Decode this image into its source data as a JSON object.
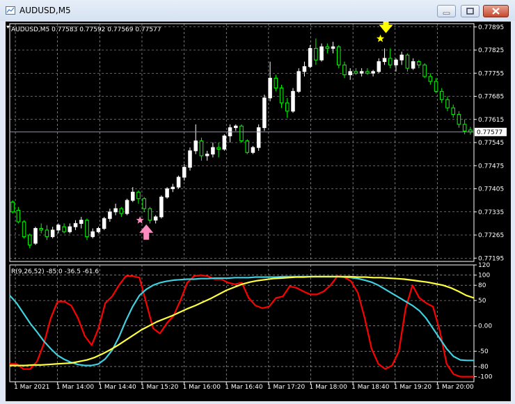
{
  "window": {
    "title": "AUDUSD,M5"
  },
  "main_chart": {
    "info_text": "AUDUSD,M5  0.77583 0.77592 0.77569 0.77577",
    "current_price_label": "0.77577",
    "price_labels": [
      "0.77895",
      "0.77825",
      "0.77755",
      "0.77685",
      "0.77615",
      "0.77545",
      "0.77475",
      "0.77405",
      "0.77335",
      "0.77265",
      "0.77195"
    ]
  },
  "indicator": {
    "info_text": "R(9,26,52) -85.0 -36.5 -61.6",
    "level_labels": [
      "120",
      "100",
      "80",
      "50",
      "0.00",
      "-50",
      "-80",
      "-100"
    ]
  },
  "time_labels": [
    "1 Mar 2021",
    "1 Mar 14:00",
    "1 Mar 14:40",
    "1 Mar 15:20",
    "1 Mar 16:00",
    "1 Mar 16:40",
    "1 Mar 17:20",
    "1 Mar 18:00",
    "1 Mar 18:40",
    "1 Mar 19:20",
    "1 Mar 20:00"
  ],
  "colors": {
    "bull": "#ffffff",
    "bear": "#00ff00",
    "grid": "#c0c0c0",
    "buy_signal": "#ff8cc0",
    "sell_signal": "#ffff00",
    "line_red": "#ff0000",
    "line_cyan": "#40d0e0",
    "line_yellow": "#ffff40"
  },
  "markers": [
    {
      "type": "buy-arrow",
      "icon": "up-arrow-icon",
      "candle_index": 23
    },
    {
      "type": "sell-arrow",
      "icon": "down-arrow-icon",
      "candle_index": 65
    }
  ],
  "chart_data": [
    {
      "type": "candlestick",
      "title": "AUDUSD,M5",
      "ylim": [
        0.77185,
        0.77905
      ],
      "x": [
        "1 Mar 2021",
        "1 Mar 14:00",
        "1 Mar 14:40",
        "1 Mar 15:20",
        "1 Mar 16:00",
        "1 Mar 16:40",
        "1 Mar 17:20",
        "1 Mar 18:00",
        "1 Mar 18:40",
        "1 Mar 19:20",
        "1 Mar 20:00"
      ],
      "ohlc": [
        [
          0.77365,
          0.7737,
          0.7733,
          0.77335
        ],
        [
          0.7734,
          0.7735,
          0.773,
          0.77305
        ],
        [
          0.77305,
          0.7731,
          0.77255,
          0.7726
        ],
        [
          0.77265,
          0.7727,
          0.77225,
          0.77235
        ],
        [
          0.7724,
          0.7729,
          0.77235,
          0.77285
        ],
        [
          0.77285,
          0.773,
          0.7727,
          0.7728
        ],
        [
          0.7728,
          0.77295,
          0.7725,
          0.7726
        ],
        [
          0.7726,
          0.7729,
          0.77255,
          0.7728
        ],
        [
          0.7728,
          0.773,
          0.7727,
          0.77295
        ],
        [
          0.7729,
          0.773,
          0.7727,
          0.77275
        ],
        [
          0.77275,
          0.773,
          0.7727,
          0.7729
        ],
        [
          0.7729,
          0.7731,
          0.7728,
          0.773
        ],
        [
          0.773,
          0.7732,
          0.77285,
          0.7731
        ],
        [
          0.7731,
          0.77315,
          0.7725,
          0.7726
        ],
        [
          0.7726,
          0.77285,
          0.77255,
          0.77275
        ],
        [
          0.77275,
          0.7729,
          0.7727,
          0.77285
        ],
        [
          0.77285,
          0.7732,
          0.7728,
          0.77315
        ],
        [
          0.77315,
          0.77345,
          0.77305,
          0.77335
        ],
        [
          0.77335,
          0.7736,
          0.77325,
          0.77345
        ],
        [
          0.77345,
          0.7735,
          0.7732,
          0.7733
        ],
        [
          0.7733,
          0.77375,
          0.77325,
          0.7737
        ],
        [
          0.7737,
          0.7741,
          0.77365,
          0.77395
        ],
        [
          0.77395,
          0.774,
          0.7736,
          0.77375
        ],
        [
          0.77375,
          0.7738,
          0.77335,
          0.77345
        ],
        [
          0.77345,
          0.7735,
          0.773,
          0.7731
        ],
        [
          0.7731,
          0.77325,
          0.773,
          0.7732
        ],
        [
          0.7732,
          0.77385,
          0.77315,
          0.7738
        ],
        [
          0.7738,
          0.7741,
          0.77375,
          0.77405
        ],
        [
          0.77405,
          0.7742,
          0.77395,
          0.7741
        ],
        [
          0.7741,
          0.77445,
          0.77405,
          0.7744
        ],
        [
          0.7744,
          0.7748,
          0.7743,
          0.7747
        ],
        [
          0.7747,
          0.7753,
          0.7746,
          0.7752
        ],
        [
          0.7752,
          0.776,
          0.7751,
          0.7755
        ],
        [
          0.7755,
          0.7756,
          0.7749,
          0.77505
        ],
        [
          0.77505,
          0.7752,
          0.7749,
          0.7751
        ],
        [
          0.7751,
          0.77545,
          0.775,
          0.7753
        ],
        [
          0.7753,
          0.77545,
          0.775,
          0.77525
        ],
        [
          0.77525,
          0.7757,
          0.7752,
          0.77565
        ],
        [
          0.77565,
          0.776,
          0.77545,
          0.7759
        ],
        [
          0.7759,
          0.776,
          0.7758,
          0.77595
        ],
        [
          0.77595,
          0.776,
          0.77545,
          0.7755
        ],
        [
          0.7755,
          0.77555,
          0.7751,
          0.77515
        ],
        [
          0.77515,
          0.77535,
          0.7751,
          0.7753
        ],
        [
          0.7753,
          0.776,
          0.7752,
          0.7759
        ],
        [
          0.7759,
          0.7769,
          0.7758,
          0.7768
        ],
        [
          0.7768,
          0.7779,
          0.7767,
          0.7774
        ],
        [
          0.7774,
          0.7775,
          0.777,
          0.7771
        ],
        [
          0.7771,
          0.7772,
          0.7765,
          0.77665
        ],
        [
          0.77665,
          0.7768,
          0.7762,
          0.7764
        ],
        [
          0.7764,
          0.7771,
          0.77635,
          0.777
        ],
        [
          0.777,
          0.7777,
          0.77695,
          0.7776
        ],
        [
          0.7776,
          0.7779,
          0.77745,
          0.77775
        ],
        [
          0.77775,
          0.7784,
          0.7777,
          0.7783
        ],
        [
          0.7783,
          0.7786,
          0.7778,
          0.77795
        ],
        [
          0.77795,
          0.77845,
          0.7779,
          0.77835
        ],
        [
          0.77835,
          0.77845,
          0.77815,
          0.7783
        ],
        [
          0.7783,
          0.7785,
          0.77815,
          0.77835
        ],
        [
          0.77835,
          0.7784,
          0.7777,
          0.7778
        ],
        [
          0.7778,
          0.7779,
          0.7774,
          0.7775
        ],
        [
          0.7775,
          0.7777,
          0.77735,
          0.7776
        ],
        [
          0.7776,
          0.7777,
          0.7775,
          0.77755
        ],
        [
          0.77755,
          0.7777,
          0.77745,
          0.7776
        ],
        [
          0.7776,
          0.7777,
          0.7775,
          0.77755
        ],
        [
          0.77755,
          0.77765,
          0.77745,
          0.7776
        ],
        [
          0.7776,
          0.778,
          0.77755,
          0.7779
        ],
        [
          0.7779,
          0.7783,
          0.7778,
          0.778
        ],
        [
          0.778,
          0.7783,
          0.7777,
          0.7778
        ],
        [
          0.7778,
          0.778,
          0.7776,
          0.77795
        ],
        [
          0.77795,
          0.7782,
          0.7778,
          0.7781
        ],
        [
          0.7781,
          0.77815,
          0.7776,
          0.7777
        ],
        [
          0.7777,
          0.778,
          0.77765,
          0.7779
        ],
        [
          0.7779,
          0.77795,
          0.7777,
          0.7778
        ],
        [
          0.7778,
          0.77785,
          0.7774,
          0.77745
        ],
        [
          0.77745,
          0.77755,
          0.7772,
          0.7773
        ],
        [
          0.7773,
          0.7774,
          0.77695,
          0.777
        ],
        [
          0.777,
          0.7771,
          0.77665,
          0.77675
        ],
        [
          0.77675,
          0.77685,
          0.7764,
          0.7765
        ],
        [
          0.7765,
          0.7766,
          0.7762,
          0.7763
        ],
        [
          0.7763,
          0.7764,
          0.7759,
          0.776
        ],
        [
          0.776,
          0.77615,
          0.7757,
          0.7758
        ],
        [
          0.77583,
          0.77592,
          0.77569,
          0.77577
        ]
      ]
    },
    {
      "type": "line",
      "title": "R(9,26,52)",
      "ylim": [
        -110,
        120
      ],
      "levels": [
        120,
        100,
        80,
        50,
        0,
        -50,
        -80,
        -100
      ],
      "series": [
        {
          "color": "#ff0000",
          "values": [
            -75,
            -75,
            -85,
            -85,
            -70,
            -35,
            15,
            48,
            48,
            40,
            15,
            -20,
            -38,
            -5,
            45,
            58,
            80,
            98,
            98,
            95,
            45,
            -5,
            -15,
            5,
            20,
            50,
            85,
            98,
            100,
            98,
            92,
            92,
            85,
            82,
            85,
            55,
            40,
            35,
            38,
            55,
            58,
            78,
            75,
            68,
            62,
            62,
            68,
            80,
            98,
            96,
            88,
            65,
            15,
            -45,
            -75,
            -85,
            -78,
            -50,
            35,
            80,
            55,
            45,
            38,
            -10,
            -75,
            -95,
            -100,
            -100,
            -100
          ]
        },
        {
          "color": "#40d0e0",
          "values": [
            60,
            45,
            25,
            5,
            -12,
            -30,
            -45,
            -58,
            -66,
            -72,
            -76,
            -78,
            -78,
            -75,
            -65,
            -48,
            -22,
            10,
            38,
            60,
            72,
            80,
            85,
            88,
            90,
            91,
            92,
            92,
            93,
            93,
            94,
            94,
            94,
            95,
            95,
            95,
            96,
            96,
            96,
            96,
            97,
            97,
            97,
            97,
            97,
            97,
            97,
            97,
            97,
            96,
            95,
            93,
            90,
            86,
            80,
            72,
            64,
            56,
            48,
            40,
            30,
            15,
            -5,
            -25,
            -45,
            -60,
            -67,
            -68,
            -68
          ]
        },
        {
          "color": "#ffff40",
          "values": [
            -78,
            -78,
            -78,
            -77,
            -77,
            -76,
            -75,
            -74,
            -73,
            -70,
            -67,
            -62,
            -55,
            -47,
            -38,
            -28,
            -18,
            -8,
            0,
            8,
            14,
            20,
            27,
            34,
            40,
            47,
            54,
            62,
            70,
            76,
            82,
            86,
            89,
            91,
            93,
            94,
            95,
            96,
            96,
            97,
            97,
            97,
            97,
            97,
            97,
            96,
            96,
            95,
            95,
            94,
            93,
            92,
            90,
            88,
            86,
            83,
            80,
            75,
            68,
            60,
            55
          ]
        }
      ]
    }
  ]
}
